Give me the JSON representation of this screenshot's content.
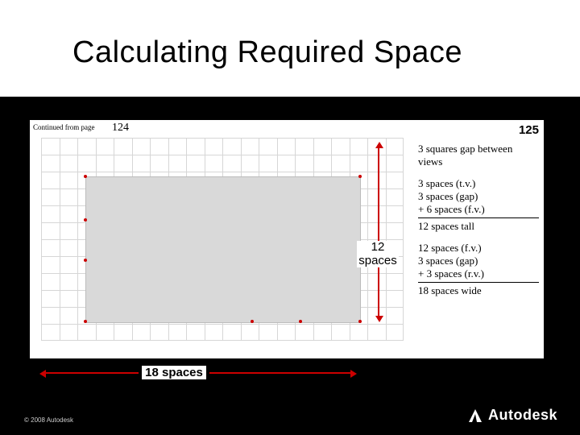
{
  "title": "Calculating Required Space",
  "paper": {
    "continued_from_label": "Continued from page",
    "prev_page": "124",
    "page_number": "125"
  },
  "dimensions": {
    "h_label": "18 spaces",
    "v_label_line1": "12",
    "v_label_line2": "spaces"
  },
  "notes": {
    "gap": "3 squares gap between views",
    "tall_1": "3 spaces (t.v.)",
    "tall_2": "3 spaces (gap)",
    "tall_3": "+ 6 spaces (f.v.)",
    "tall_sum": "12 spaces tall",
    "wide_1": "12 spaces (f.v.)",
    "wide_2": "3 spaces (gap)",
    "wide_3": "+ 3 spaces (r.v.)",
    "wide_sum": "18 spaces wide"
  },
  "footer": {
    "copyright": "© 2008 Autodesk",
    "brand": "Autodesk"
  }
}
